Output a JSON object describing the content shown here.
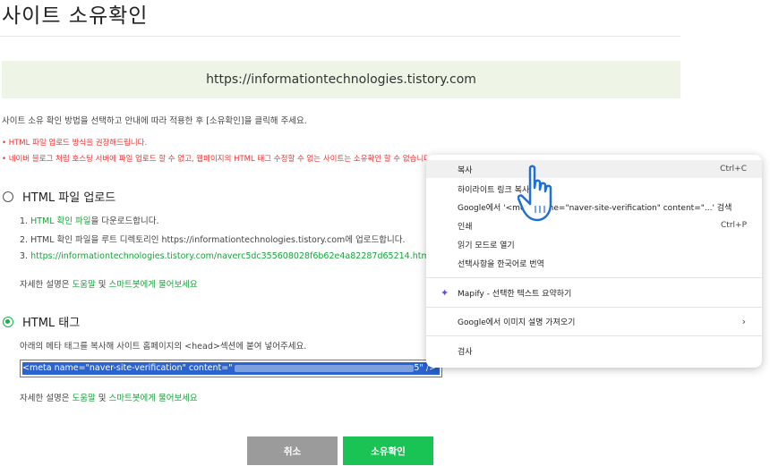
{
  "page": {
    "title": "사이트 소유확인",
    "url": "https://informationtechnologies.tistory.com",
    "intro": "사이트 소유 확인 방법을 선택하고 안내에 따라 적용한 후 [소유확인]을 클릭해 주세요.",
    "warn1": "• HTML 파일 업로드 방식을 권장해드립니다.",
    "warn2": "• 네이버 블로그 처럼 호스팅 서버에 파일 업로드 할 수 없고, 웹페이지의 HTML 태그 수정할 수 없는 사이트는 소유확인 할 수 없습니다."
  },
  "upload": {
    "label": "HTML 파일 업로드",
    "step1_prefix": "1. ",
    "step1_link": "HTML 확인 파일",
    "step1_suffix": "을 다운로드합니다.",
    "step2": "2. HTML 확인 파일을 루트 디렉토리인 https://informationtechnologies.tistory.com에 업로드합니다.",
    "step3_prefix": "3. ",
    "step3_link": "https://informationtechnologies.tistory.com/naverc5dc355608028f6b62e4a82287d65214.html",
    "help_prefix": "자세한 설명은 ",
    "help_link1": "도움말",
    "help_mid": " 및 ",
    "help_link2": "스마트봇에게 물어보세요"
  },
  "tag": {
    "label": "HTML 태그",
    "desc": "아래의 메타 태그를 복사해 사이트 홈페이지의 <head>섹션에 붙여 넣어주세요.",
    "meta_value": "<meta name=\"naver-site-verification\" content=\"",
    "meta_end": "5\" />",
    "help_prefix": "자세한 설명은 ",
    "help_link1": "도움말",
    "help_mid": " 및 ",
    "help_link2": "스마트봇에게 물어보세요"
  },
  "buttons": {
    "cancel": "취소",
    "confirm": "소유확인"
  },
  "context_menu": {
    "copy": "복사",
    "copy_shortcut": "Ctrl+C",
    "highlight_link": "하이라이트 링크 복사",
    "google_search": "Google에서 '<meta name=\"naver-site-verification\" content=\"...' 검색",
    "print": "인쇄",
    "print_shortcut": "Ctrl+P",
    "reading_mode": "읽기 모드로 열기",
    "translate": "선택사항을 한국어로 번역",
    "mapify": "Mapify - 선택한 텍스트 요약하기",
    "image_desc": "Google에서 이미지 설명 가져오기",
    "inspect": "검사"
  },
  "colors": {
    "accent": "#19c354",
    "warn": "#ee3333",
    "selection": "#2b63cf",
    "urlbox": "#eef5e6"
  }
}
